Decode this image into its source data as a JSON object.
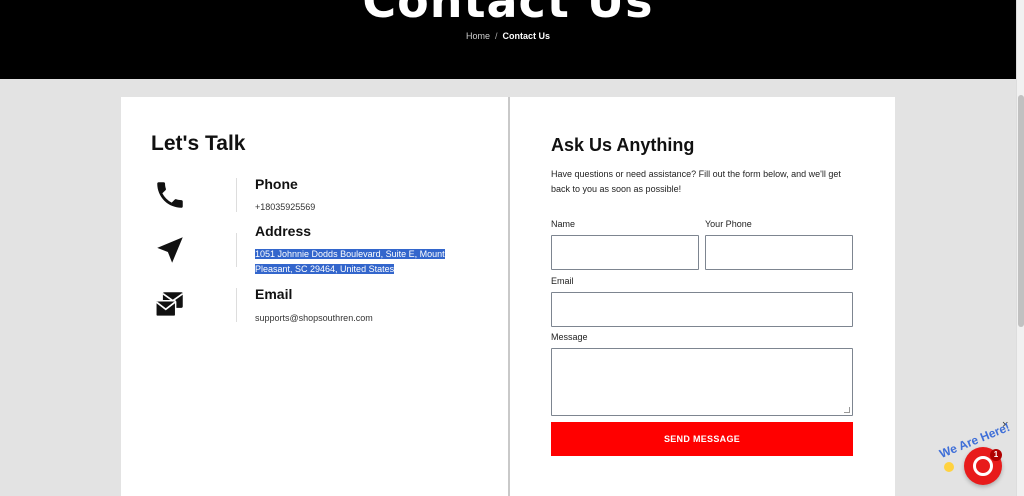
{
  "hero": {
    "title": "Contact Us",
    "breadcrumb": {
      "home": "Home",
      "separator": "/",
      "current": "Contact Us"
    }
  },
  "contact_info": {
    "title": "Let's Talk",
    "phone": {
      "icon": "phone-icon",
      "label": "Phone",
      "value": "+18035925569"
    },
    "address": {
      "icon": "location-arrow-icon",
      "label": "Address",
      "value": "1051 Johnnie Dodds Boulevard, Suite E, Mount Pleasant, SC 29464, United States"
    },
    "email": {
      "icon": "mail-icon",
      "label": "Email",
      "value": "supports@shopsouthren.com"
    }
  },
  "form": {
    "title": "Ask Us Anything",
    "intro": "Have questions or need assistance? Fill out the form below, and we'll get back to you as soon as possible!",
    "name_label": "Name",
    "phone_label": "Your Phone",
    "email_label": "Email",
    "message_label": "Message",
    "name_value": "",
    "phone_value": "",
    "email_value": "",
    "message_value": "",
    "submit_label": "SEND MESSAGE"
  },
  "chat_widget": {
    "badge_text": "We Are Here!",
    "notification_count": "1",
    "close_symbol": "×"
  },
  "colors": {
    "accent": "#ff0000",
    "hero_bg": "#000000",
    "page_bg": "#e3e3e3",
    "selection": "#3366cc"
  }
}
